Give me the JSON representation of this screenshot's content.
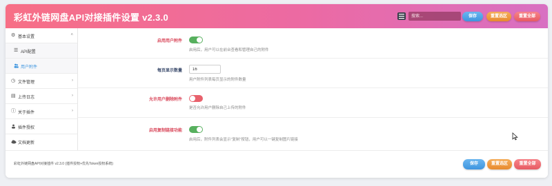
{
  "header": {
    "title": "彩虹外链网盘API对接插件设置 v2.3.0",
    "menu_icon": "list-icon",
    "search_placeholder": "搜索...",
    "save_label": "保存",
    "reset_section_label": "重置选区",
    "reset_all_label": "重置全部"
  },
  "sidebar": {
    "items": [
      {
        "label": "基本设置",
        "icon": "gear-icon",
        "expanded": true
      },
      {
        "label": "API配置",
        "icon": "list-icon",
        "sub": true
      },
      {
        "label": "用户附件",
        "icon": "users-icon",
        "sub": true,
        "active": true
      },
      {
        "label": "文件管理",
        "icon": "clock-icon"
      },
      {
        "label": "上传日志",
        "icon": "document-icon"
      },
      {
        "label": "关于插件",
        "icon": "info-icon"
      },
      {
        "label": "插件授权",
        "icon": "user-group-icon"
      },
      {
        "label": "文档更新",
        "icon": "cloud-icon"
      }
    ]
  },
  "settings": {
    "enable_attachments": {
      "label": "启用用户附件",
      "enabled": true,
      "description": "启用后，用户可以在前台查看和管理自己的附件"
    },
    "per_page": {
      "label": "每页显示数量",
      "value": "16",
      "description": "用户附件列表每页显示的附件数量"
    },
    "allow_delete": {
      "label": "允许用户删除附件",
      "enabled": false,
      "description": "是否允许用户删除自己上传的附件"
    },
    "enable_copy_link": {
      "label": "启用复制链接功能",
      "enabled": true,
      "description": "启用后，附件列表会显示\"复制\"按钮，用户可以一键复制图片链接"
    }
  },
  "footer": {
    "text": "彩虹外链网盘API对接插件 v2.3.0 (插件授权+优先Token授权系统)",
    "save_label": "保存",
    "reset_section_label": "重置选区",
    "reset_all_label": "重置全部"
  },
  "colors": {
    "header_start": "#f76f86",
    "header_end": "#d870c2",
    "save": "#3e95df",
    "reset_section": "#e88a2e",
    "reset_all": "#e85a62",
    "toggle_on": "#57b05e",
    "toggle_off": "#e8616c",
    "required_label": "#d9475a"
  }
}
